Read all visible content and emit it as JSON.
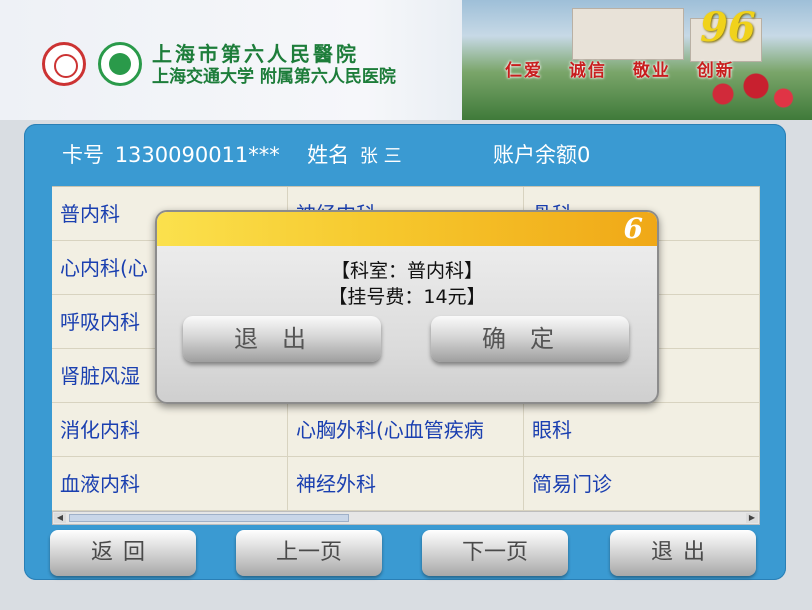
{
  "header": {
    "hospital_name_line1": "上海市第六人民醫院",
    "hospital_name_line2": "上海交通大学 附属第六人民医院",
    "logo_number": "96",
    "motto": [
      "仁爱",
      "诚信",
      "敬业",
      "创新"
    ]
  },
  "patient": {
    "card_label": "卡号",
    "card_value": "1330090011***",
    "name_label": "姓名",
    "name_value": "张 三",
    "balance_label": "账户余额",
    "balance_value": "0"
  },
  "departments": [
    [
      "普内科",
      "神经内科",
      "骨科"
    ],
    [
      "心内科(心",
      "",
      ""
    ],
    [
      "呼吸内科",
      "",
      ""
    ],
    [
      "肾脏风湿",
      "",
      ""
    ],
    [
      "消化内科",
      "心胸外科(心血管疾病",
      "眼科"
    ],
    [
      "血液内科",
      "神经外科",
      "简易门诊"
    ]
  ],
  "dialog": {
    "countdown": "6",
    "line1": "【科室：普内科】",
    "line2": "【挂号费：14元】",
    "exit_label": "退出",
    "confirm_label": "确定"
  },
  "nav": {
    "back": "返回",
    "prev": "上一页",
    "next": "下一页",
    "exit": "退出"
  },
  "colors": {
    "frame": "#3a9ad2",
    "department_text": "#1a3fb0",
    "motto": "#c81e1e",
    "dialog_title": "#f6c82d"
  }
}
